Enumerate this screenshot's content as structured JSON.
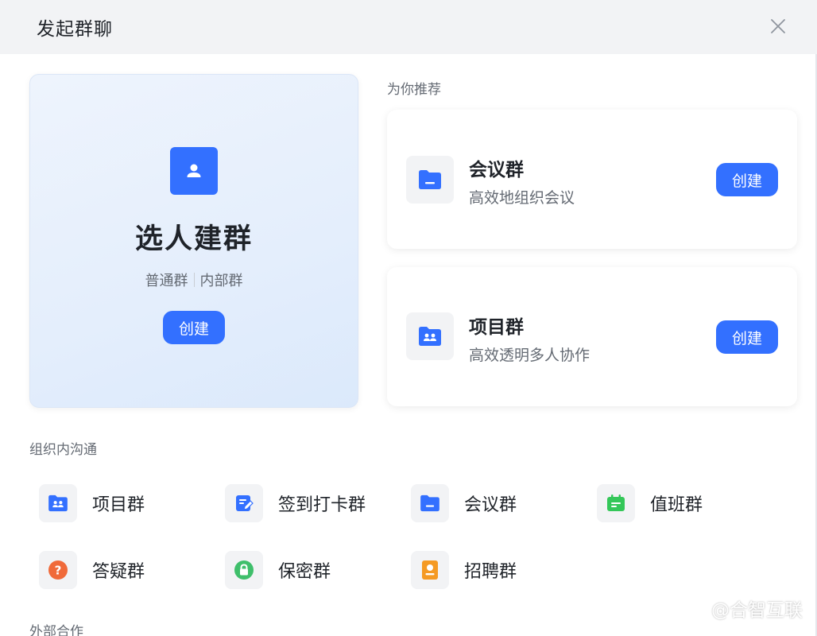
{
  "header": {
    "title": "发起群聊"
  },
  "hero": {
    "title": "选人建群",
    "sub_left": "普通群",
    "sub_right": "内部群",
    "button_label": "创建"
  },
  "recommend": {
    "label": "为你推荐",
    "cards": [
      {
        "title": "会议群",
        "desc": "高效地组织会议",
        "button_label": "创建"
      },
      {
        "title": "项目群",
        "desc": "高效透明多人协作",
        "button_label": "创建"
      }
    ]
  },
  "internal": {
    "label": "组织内沟通",
    "items": [
      {
        "label": "项目群",
        "icon": "folder-team-icon"
      },
      {
        "label": "签到打卡群",
        "icon": "checkin-edit-icon"
      },
      {
        "label": "会议群",
        "icon": "folder-icon"
      },
      {
        "label": "值班群",
        "icon": "calendar-icon"
      },
      {
        "label": "答疑群",
        "icon": "question-icon"
      },
      {
        "label": "保密群",
        "icon": "lock-icon"
      },
      {
        "label": "招聘群",
        "icon": "recruit-icon"
      }
    ]
  },
  "external": {
    "label": "外部合作"
  },
  "watermark": {
    "text": "@合智互联"
  },
  "colors": {
    "accent": "#3370ff",
    "calendar_green": "#34c759",
    "question_orange": "#f06a3a",
    "lock_green": "#3fbf6b",
    "recruit_orange": "#f59a23"
  }
}
